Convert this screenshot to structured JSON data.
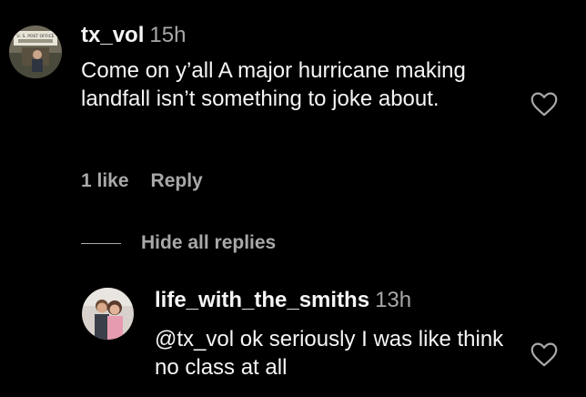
{
  "comment": {
    "username": "tx_vol",
    "time": "15h",
    "text": "Come on y’all A major hurricane making landfall isn’t something to joke about.",
    "likes": "1 like",
    "reply_label": "Reply",
    "avatar_sign_text": "U. S. POST OFFICE"
  },
  "replies_toggle": {
    "label": "Hide all replies"
  },
  "reply": {
    "username": "life_with_the_smiths",
    "time": "13h",
    "text": "@tx_vol ok seriously I was like think no class at all"
  },
  "icons": {
    "like": "heart-outline-icon"
  },
  "colors": {
    "background": "#000000",
    "primary_text": "#f5f5f5",
    "secondary_text": "#a8a8a8"
  }
}
